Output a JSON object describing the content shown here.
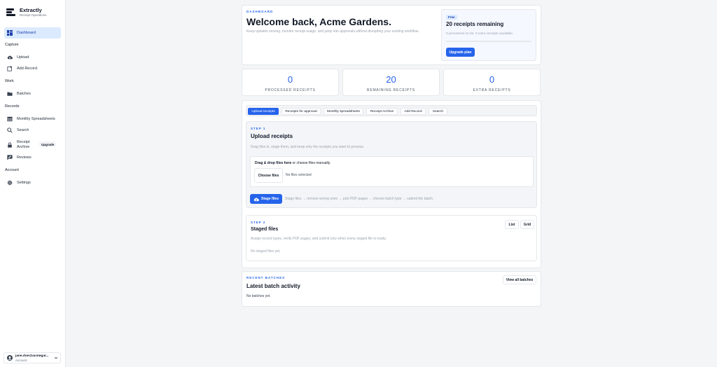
{
  "brand": {
    "name": "Extractly",
    "subtitle": "Receipt Operations"
  },
  "sidebar": {
    "dashboard": "Dashboard",
    "capture_label": "Capture",
    "upload": "Upload",
    "add_record": "Add Record",
    "work_label": "Work",
    "batches": "Batches",
    "records_label": "Records",
    "monthly_spreadsheets": "Monthly Spreadsheets",
    "search": "Search",
    "receipt_archive_1": "Receipt",
    "receipt_archive_2": "Archive",
    "upgrade_badge": "Upgrade",
    "reviews": "Reviews",
    "account_label": "Account",
    "settings": "Settings"
  },
  "account": {
    "email": "jane.doe@acmegar...",
    "role": "Account"
  },
  "hero": {
    "eyebrow": "DASHBOARD",
    "title": "Welcome back, Acme Gardens.",
    "subtitle": "Keep uploads moving, monitor receipt usage, and jump into approvals without disrupting your existing workflow."
  },
  "plan": {
    "badge": "Free",
    "title": "20 receipts remaining",
    "detail": "0 processed so far. 0 extra receipts available.",
    "upgrade_button": "Upgrade plan",
    "progress": 0
  },
  "stats": [
    {
      "value": "0",
      "label": "PROCESSED RECEIPTS"
    },
    {
      "value": "20",
      "label": "REMAINING RECEIPTS"
    },
    {
      "value": "0",
      "label": "EXTRA RECEIPTS"
    }
  ],
  "tabs": {
    "upload_receipts": "Upload receipts",
    "receipts_for_approval": "Receipts for approval",
    "monthly_spreadsheets": "Monthly spreadsheets",
    "receipt_archive": "Receipt Archive",
    "add_record": "Add Record",
    "search": "Search"
  },
  "step1": {
    "eyebrow": "STEP 1",
    "title": "Upload receipts",
    "subtitle": "Drag files in, stage them, and keep only the receipts you want to process.",
    "drop_bold": "Drag & drop files here",
    "drop_rest": " or choose files manually.",
    "choose_button": "Choose files",
    "no_files": "No files selected",
    "stage_button": "Stage files",
    "stage_hint": "Stage files → remove wrong ones → pick PDF pages → choose batch type → submit the batch."
  },
  "step2": {
    "eyebrow": "STEP 2",
    "title": "Staged files",
    "subtitle": "Assign record types, verify PDF pages, and submit only when every staged file is ready.",
    "empty": "No staged files yet.",
    "list_button": "List",
    "grid_button": "Grid"
  },
  "recent": {
    "eyebrow": "RECENT BATCHES",
    "title": "Latest batch activity",
    "empty": "No batches yet.",
    "view_all": "View all batches"
  },
  "colors": {
    "accent": "#2563eb",
    "active_nav_bg": "#dbeafe"
  }
}
